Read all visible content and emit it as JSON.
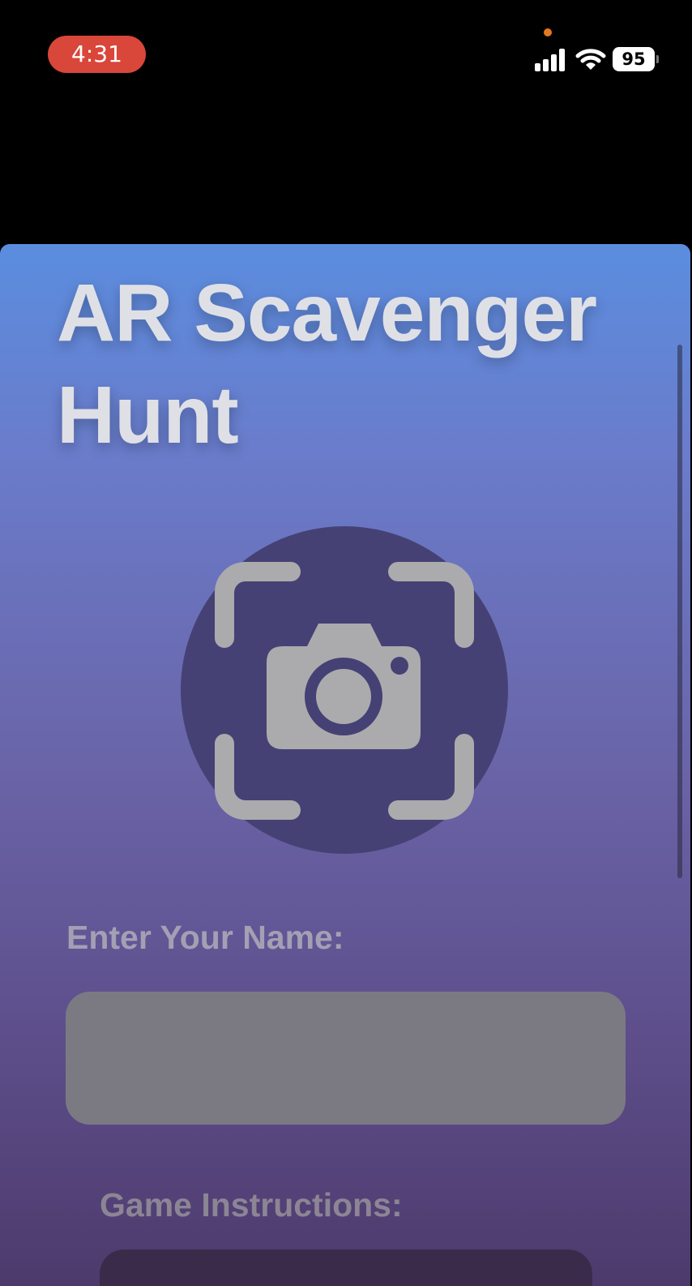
{
  "status_bar": {
    "time": "4:31",
    "battery": "95",
    "icons": [
      "signal-icon",
      "wifi-icon",
      "battery-icon"
    ]
  },
  "app": {
    "title": "AR Scavenger Hunt",
    "logo_icon": "camera-viewfinder-icon",
    "name_label": "Enter Your Name:",
    "name_value": "",
    "instructions_label": "Game Instructions:"
  },
  "colors": {
    "gradient_top": "#5b8ddf",
    "gradient_bottom": "#4d3a6c",
    "time_pill": "#d9463a",
    "logo_circle": "#454174",
    "logo_glyph": "#ababad",
    "input_fill": "#7b7a82"
  }
}
